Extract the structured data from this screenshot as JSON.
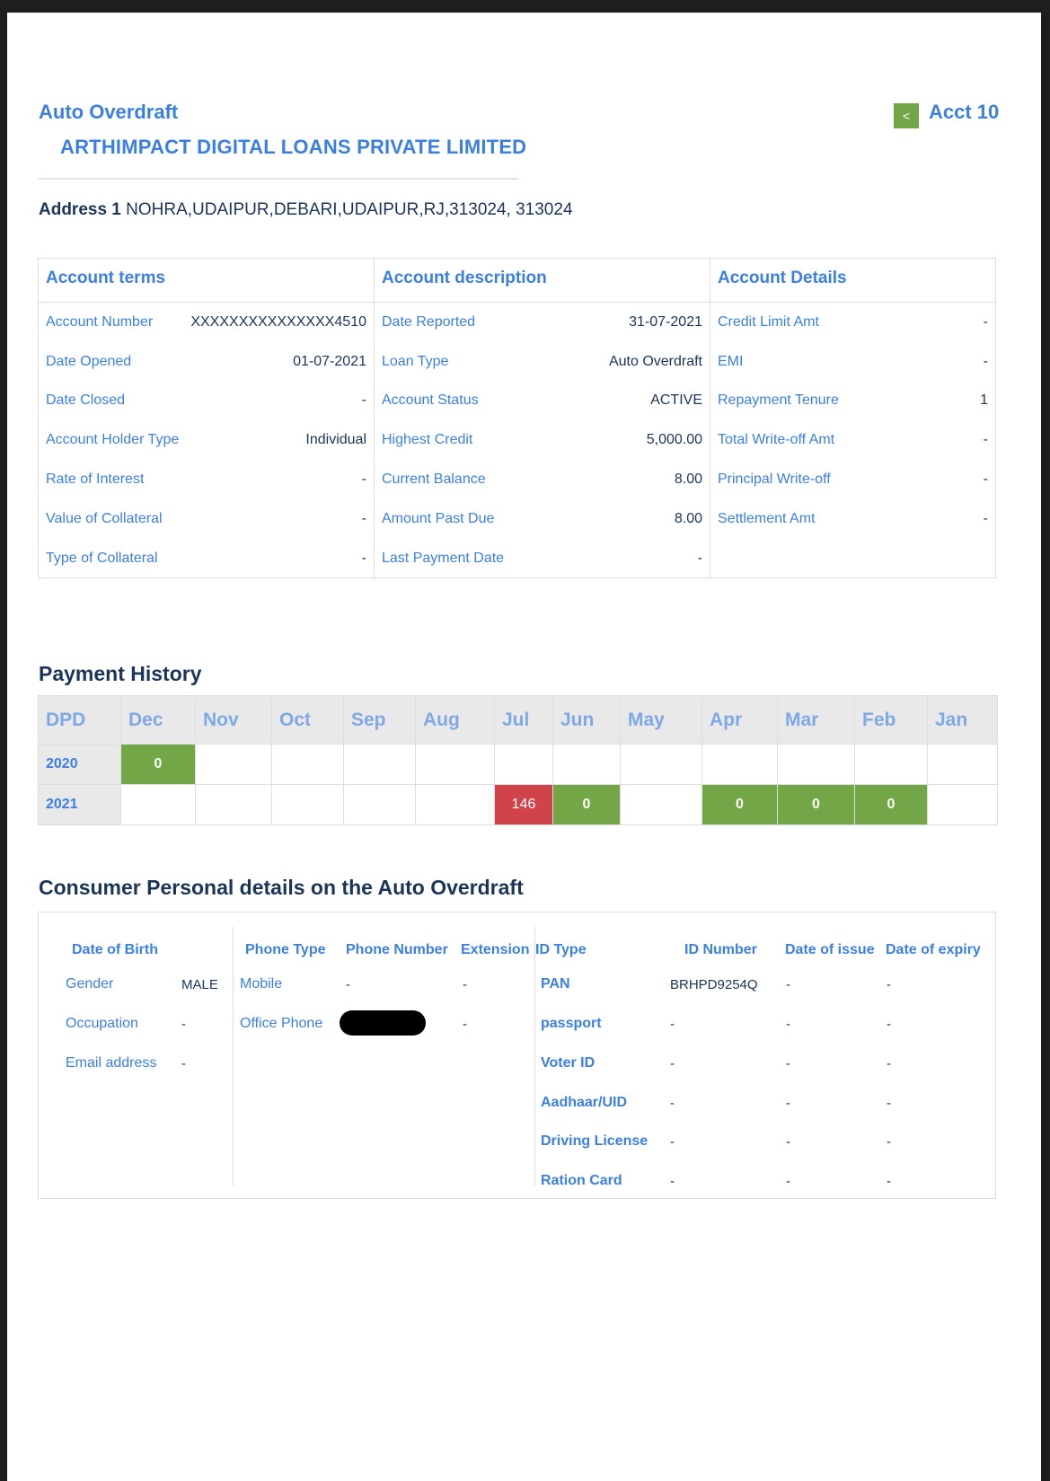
{
  "header": {
    "account_type": "Auto Overdraft",
    "lender": "ARTHIMPACT DIGITAL LOANS PRIVATE LIMITED",
    "nav_prev": "<",
    "account_label": "Acct 10",
    "address_label": "Address 1",
    "address_value": "NOHRA,UDAIPUR,DEBARI,UDAIPUR,RJ,313024, 313024"
  },
  "account_terms": {
    "title": "Account terms",
    "rows": [
      {
        "k": "Account Number",
        "v": "XXXXXXXXXXXXXXX4510"
      },
      {
        "k": "Date Opened",
        "v": "01-07-2021"
      },
      {
        "k": "Date Closed",
        "v": "-"
      },
      {
        "k": "Account Holder Type",
        "v": "Individual"
      },
      {
        "k": "Rate of Interest",
        "v": "-"
      },
      {
        "k": "Value of Collateral",
        "v": "-"
      },
      {
        "k": "Type of Collateral",
        "v": "-"
      }
    ]
  },
  "account_description": {
    "title": "Account description",
    "rows": [
      {
        "k": "Date Reported",
        "v": "31-07-2021"
      },
      {
        "k": "Loan Type",
        "v": "Auto Overdraft"
      },
      {
        "k": "Account Status",
        "v": "ACTIVE"
      },
      {
        "k": "Highest Credit",
        "v": "5,000.00"
      },
      {
        "k": "Current Balance",
        "v": "8.00"
      },
      {
        "k": "Amount Past Due",
        "v": "8.00"
      },
      {
        "k": "Last Payment Date",
        "v": "-"
      }
    ]
  },
  "account_details": {
    "title": "Account Details",
    "rows": [
      {
        "k": "Credit Limit Amt",
        "v": "-"
      },
      {
        "k": "EMI",
        "v": "-"
      },
      {
        "k": "Repayment Tenure",
        "v": "1"
      },
      {
        "k": "Total Write-off Amt",
        "v": "-"
      },
      {
        "k": "Principal Write-off",
        "v": "-"
      },
      {
        "k": "Settlement Amt",
        "v": "-"
      }
    ]
  },
  "payment_history": {
    "title": "Payment History",
    "headers": [
      "DPD",
      "Dec",
      "Nov",
      "Oct",
      "Sep",
      "Aug",
      "Jul",
      "Jun",
      "May",
      "Apr",
      "Mar",
      "Feb",
      "Jan"
    ],
    "rows": [
      {
        "year": "2020",
        "cells": [
          "0",
          "",
          "",
          "",
          "",
          "",
          "",
          "",
          "",
          "",
          "",
          ""
        ]
      },
      {
        "year": "2021",
        "cells": [
          "",
          "",
          "",
          "",
          "",
          "146",
          "0",
          "",
          "0",
          "0",
          "0",
          ""
        ]
      }
    ],
    "colors": {
      "green": "#72a646",
      "red": "#d0434a"
    }
  },
  "personal": {
    "title": "Consumer Personal details on the Auto Overdraft",
    "dob_label": "Date of Birth",
    "gender_label": "Gender",
    "gender_value": "MALE",
    "occupation_label": "Occupation",
    "occupation_value": "-",
    "email_label": "Email address",
    "email_value": "-",
    "phone_headers": {
      "type": "Phone Type",
      "number": "Phone Number",
      "ext": "Extension"
    },
    "phones": [
      {
        "type": "Mobile",
        "number": "-",
        "ext": "-"
      },
      {
        "type": "Office Phone",
        "number": "",
        "ext": "-"
      }
    ],
    "id_headers": {
      "type": "ID Type",
      "number": "ID Number",
      "issue": "Date of issue",
      "expiry": "Date of expiry"
    },
    "ids": [
      {
        "type": "PAN",
        "number": "BRHPD9254Q",
        "issue": "-",
        "expiry": "-"
      },
      {
        "type": "passport",
        "number": "-",
        "issue": "-",
        "expiry": "-"
      },
      {
        "type": "Voter ID",
        "number": "-",
        "issue": "-",
        "expiry": "-"
      },
      {
        "type": "Aadhaar/UID",
        "number": "-",
        "issue": "-",
        "expiry": "-"
      },
      {
        "type": "Driving License",
        "number": "-",
        "issue": "-",
        "expiry": "-"
      },
      {
        "type": "Ration Card",
        "number": "-",
        "issue": "-",
        "expiry": "-"
      }
    ]
  }
}
